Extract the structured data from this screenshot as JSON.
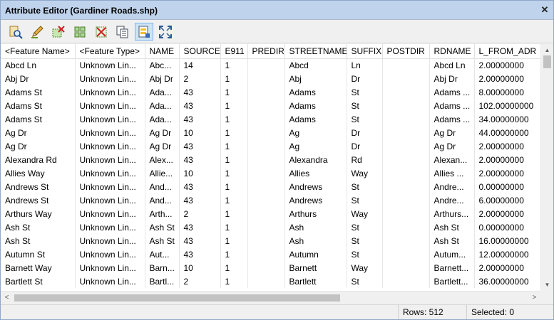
{
  "window": {
    "title": "Attribute Editor (Gardiner Roads.shp)",
    "close_glyph": "✕"
  },
  "toolbar": {
    "buttons": [
      {
        "name": "zoom-to-feature-button",
        "icon": "magnify-page-icon"
      },
      {
        "name": "edit-feature-button",
        "icon": "pencil-icon"
      },
      {
        "name": "delete-selected-button",
        "icon": "delete-selection-icon"
      },
      {
        "name": "select-all-button",
        "icon": "select-all-icon"
      },
      {
        "name": "clear-selection-button",
        "icon": "clear-selection-icon"
      },
      {
        "name": "copy-button",
        "icon": "copy-pages-icon"
      },
      {
        "name": "show-selected-button",
        "icon": "show-selected-icon",
        "active": true
      },
      {
        "name": "zoom-to-selected-button",
        "icon": "expand-arrows-icon"
      }
    ]
  },
  "table": {
    "columns": [
      "<Feature Name>",
      "<Feature Type>",
      "NAME",
      "SOURCE",
      "E911",
      "PREDIR",
      "STREETNAME",
      "SUFFIX",
      "POSTDIR",
      "RDNAME",
      "L_FROM_ADR"
    ],
    "rows": [
      [
        "Abcd Ln",
        "Unknown Lin...",
        "Abc...",
        "14",
        "1",
        "",
        "Abcd",
        "Ln",
        "",
        "Abcd Ln",
        "2.00000000"
      ],
      [
        "Abj Dr",
        "Unknown Lin...",
        "Abj Dr",
        "2",
        "1",
        "",
        "Abj",
        "Dr",
        "",
        "Abj Dr",
        "2.00000000"
      ],
      [
        "Adams St",
        "Unknown Lin...",
        "Ada...",
        "43",
        "1",
        "",
        "Adams",
        "St",
        "",
        "Adams ...",
        "8.00000000"
      ],
      [
        "Adams St",
        "Unknown Lin...",
        "Ada...",
        "43",
        "1",
        "",
        "Adams",
        "St",
        "",
        "Adams ...",
        "102.00000000"
      ],
      [
        "Adams St",
        "Unknown Lin...",
        "Ada...",
        "43",
        "1",
        "",
        "Adams",
        "St",
        "",
        "Adams ...",
        "34.00000000"
      ],
      [
        "Ag Dr",
        "Unknown Lin...",
        "Ag Dr",
        "10",
        "1",
        "",
        "Ag",
        "Dr",
        "",
        "Ag Dr",
        "44.00000000"
      ],
      [
        "Ag Dr",
        "Unknown Lin...",
        "Ag Dr",
        "43",
        "1",
        "",
        "Ag",
        "Dr",
        "",
        "Ag Dr",
        "2.00000000"
      ],
      [
        "Alexandra Rd",
        "Unknown Lin...",
        "Alex...",
        "43",
        "1",
        "",
        "Alexandra",
        "Rd",
        "",
        "Alexan...",
        "2.00000000"
      ],
      [
        "Allies Way",
        "Unknown Lin...",
        "Allie...",
        "10",
        "1",
        "",
        "Allies",
        "Way",
        "",
        "Allies ...",
        "2.00000000"
      ],
      [
        "Andrews St",
        "Unknown Lin...",
        "And...",
        "43",
        "1",
        "",
        "Andrews",
        "St",
        "",
        "Andre...",
        "0.00000000"
      ],
      [
        "Andrews St",
        "Unknown Lin...",
        "And...",
        "43",
        "1",
        "",
        "Andrews",
        "St",
        "",
        "Andre...",
        "6.00000000"
      ],
      [
        "Arthurs Way",
        "Unknown Lin...",
        "Arth...",
        "2",
        "1",
        "",
        "Arthurs",
        "Way",
        "",
        "Arthurs...",
        "2.00000000"
      ],
      [
        "Ash St",
        "Unknown Lin...",
        "Ash St",
        "43",
        "1",
        "",
        "Ash",
        "St",
        "",
        "Ash St",
        "0.00000000"
      ],
      [
        "Ash St",
        "Unknown Lin...",
        "Ash St",
        "43",
        "1",
        "",
        "Ash",
        "St",
        "",
        "Ash St",
        "16.00000000"
      ],
      [
        "Autumn St",
        "Unknown Lin...",
        "Aut...",
        "43",
        "1",
        "",
        "Autumn",
        "St",
        "",
        "Autum...",
        "12.00000000"
      ],
      [
        "Barnett Way",
        "Unknown Lin...",
        "Barn...",
        "10",
        "1",
        "",
        "Barnett",
        "Way",
        "",
        "Barnett...",
        "2.00000000"
      ],
      [
        "Bartlett St",
        "Unknown Lin...",
        "Bartl...",
        "2",
        "1",
        "",
        "Bartlett",
        "St",
        "",
        "Bartlett...",
        "36.00000000"
      ]
    ]
  },
  "scroll": {
    "up": "▲",
    "down": "▼",
    "left": "<",
    "right": ">"
  },
  "status": {
    "rows_label": "Rows: 512",
    "selected_label": "Selected: 0"
  }
}
